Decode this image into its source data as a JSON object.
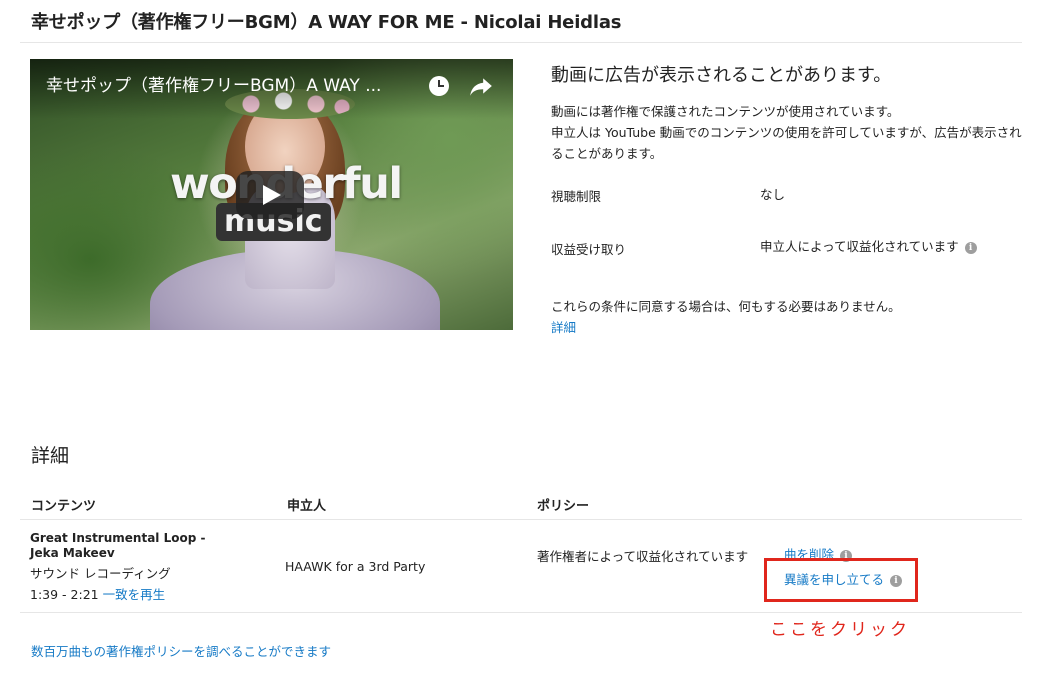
{
  "header": {
    "title": "幸せポップ（著作権フリーBGM）A WAY FOR ME - Nicolai Heidlas"
  },
  "video": {
    "title": "幸せポップ（著作権フリーBGM）A WAY ...",
    "overlay_word": "wonderful",
    "overlay_badge": "music"
  },
  "notice": {
    "heading": "動画に広告が表示されることがあります。",
    "line1": "動画には著作権で保護されたコンテンツが使用されています。",
    "line2": "申立人は YouTube 動画でのコンテンツの使用を許可していますが、広告が表示されることがあります。",
    "restriction_label": "視聴制限",
    "restriction_value": "なし",
    "monetization_label": "収益受け取り",
    "monetization_value": "申立人によって収益化されています",
    "info_glyph": "i",
    "agree_text": "これらの条件に同意する場合は、何もする必要はありません。",
    "details_link": "詳細"
  },
  "details": {
    "title": "詳細",
    "columns": [
      "コンテンツ",
      "申立人",
      "ポリシー"
    ],
    "row": {
      "content_title": "Great Instrumental Loop - Jeka Makeev",
      "content_type": "サウンド レコーディング",
      "time_range": "1:39 - 2:21",
      "match_link": "一致を再生",
      "claimant": "HAAWK for a 3rd Party",
      "policy": "著作権者によって収益化されています",
      "remove_song": "曲を削除",
      "dispute": "異議を申し立てる"
    }
  },
  "annotation": {
    "text": "ここをクリック",
    "color": "#e0261c"
  },
  "footer": {
    "policy_search_link": "数百万曲もの著作権ポリシーを調べることができます"
  },
  "colors": {
    "link": "#167ac6",
    "text": "#222222",
    "divider": "#e6e6e6"
  }
}
